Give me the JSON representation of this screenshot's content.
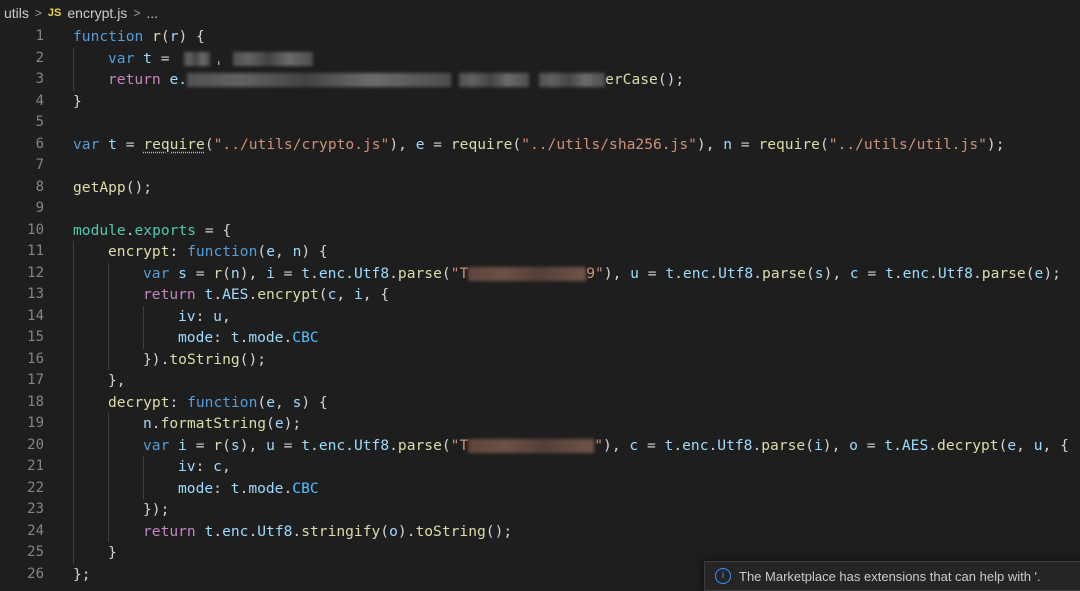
{
  "breadcrumb": {
    "folder": "utils",
    "file_icon": "JS",
    "file": "encrypt.js",
    "more": "..."
  },
  "code_lines": [
    {
      "n": "1"
    },
    {
      "n": "2"
    },
    {
      "n": "3"
    },
    {
      "n": "4"
    },
    {
      "n": "5"
    },
    {
      "n": "6"
    },
    {
      "n": "7"
    },
    {
      "n": "8"
    },
    {
      "n": "9"
    },
    {
      "n": "10"
    },
    {
      "n": "11"
    },
    {
      "n": "12"
    },
    {
      "n": "13"
    },
    {
      "n": "14"
    },
    {
      "n": "15"
    },
    {
      "n": "16"
    },
    {
      "n": "17"
    },
    {
      "n": "18"
    },
    {
      "n": "19"
    },
    {
      "n": "20"
    },
    {
      "n": "21"
    },
    {
      "n": "22"
    },
    {
      "n": "23"
    },
    {
      "n": "24"
    },
    {
      "n": "25"
    },
    {
      "n": "26"
    }
  ],
  "tokens": {
    "l1": {
      "kw": "function",
      "name": "r",
      "open": "(",
      "param": "r",
      "close": ") {"
    },
    "l2": {
      "kw": "var",
      "name": "t",
      "eq": " = ",
      "tick": "ˌ"
    },
    "l3": {
      "kw": "return",
      "obj": "e.",
      "tail": "erCase",
      "end": "();"
    },
    "l4": {
      "t": "}"
    },
    "l6": {
      "kw": "var",
      "t": "t",
      "eq": " = ",
      "req": "require",
      "p1": "(",
      "s1": "\"../utils/crypto.js\"",
      "m1": "), ",
      "e": "e",
      "eq2": " = ",
      "req2": "require",
      "p2": "(",
      "s2": "\"../utils/sha256.js\"",
      "m2": "), ",
      "n": "n",
      "eq3": " = ",
      "req3": "require",
      "p3": "(",
      "s3": "\"../utils/util.js\"",
      "end": ");"
    },
    "l8": {
      "fn": "getApp",
      "end": "();"
    },
    "l10": {
      "mod": "module",
      "dot": ".",
      "exp": "exports",
      "rest": " = {"
    },
    "l11": {
      "name": "encrypt",
      "colon": ": ",
      "kw": "function",
      "open": "(",
      "a": "e",
      "c": ", ",
      "b": "n",
      "close": ") {"
    },
    "l12": {
      "kw": "var",
      "s": "s",
      "eq": " = ",
      "r": "r",
      "o": "(",
      "n": "n",
      "c1": "), ",
      "i": "i",
      "eq2": " = ",
      "t": "t",
      "d1": ".",
      "enc": "enc",
      "d2": ".",
      "utf": "Utf8",
      "d3": ".",
      "parse": "parse",
      "o2": "(",
      "s1": "\"T",
      "s2": "9\"",
      "c2": "), ",
      "u": "u",
      "eq3": " = ",
      "t2": "t",
      "d4": ".",
      "enc2": "enc",
      "d5": ".",
      "utf2": "Utf8",
      "d6": ".",
      "parse2": "parse",
      "o3": "(",
      "sv": "s",
      "c3": "), ",
      "c": "c",
      "eq4": " = ",
      "t3": "t",
      "d7": ".",
      "enc3": "enc",
      "d8": ".",
      "utf3": "Utf8",
      "d9": ".",
      "parse3": "parse",
      "o4": "(",
      "ev": "e",
      "end": ");"
    },
    "l13": {
      "kw": "return",
      "t": "t",
      "d1": ".",
      "aes": "AES",
      "d2": ".",
      "fn": "encrypt",
      "o": "(",
      "c": "c",
      "cm": ", ",
      "i": "i",
      "end": ", {"
    },
    "l14": {
      "k": "iv",
      "c": ": ",
      "v": "u",
      "end": ","
    },
    "l15": {
      "k": "mode",
      "c": ": ",
      "t": "t",
      "d": ".",
      "m": "mode",
      "d2": ".",
      "cbc": "CBC"
    },
    "l16": {
      "a": "})",
      "d": ".",
      "fn": "toString",
      "end": "();"
    },
    "l17": {
      "t": "},"
    },
    "l18": {
      "name": "decrypt",
      "colon": ": ",
      "kw": "function",
      "open": "(",
      "a": "e",
      "c": ", ",
      "b": "s",
      "close": ") {"
    },
    "l19": {
      "n": "n",
      "d": ".",
      "fn": "formatString",
      "o": "(",
      "e": "e",
      "end": ");"
    },
    "l20": {
      "kw": "var",
      "i": "i",
      "eq": " = ",
      "r": "r",
      "o": "(",
      "s": "s",
      "c1": "), ",
      "u": "u",
      "eq2": " = ",
      "t": "t",
      "d1": ".",
      "enc": "enc",
      "d2": ".",
      "utf": "Utf8",
      "d3": ".",
      "parse": "parse",
      "o2": "(",
      "s1": "\"T",
      "s2": "\"",
      "c2": "), ",
      "c": "c",
      "eq3": " = ",
      "t2": "t",
      "d4": ".",
      "enc2": "enc",
      "d5": ".",
      "utf2": "Utf8",
      "d6": ".",
      "parse2": "parse",
      "o3": "(",
      "iv": "i",
      "c3": "), ",
      "ov": "o",
      "eq4": " = ",
      "t3": "t",
      "d7": ".",
      "aes": "AES",
      "d8": ".",
      "dec": "decrypt",
      "o4": "(",
      "ev": "e",
      "cm": ", ",
      "uv": "u",
      "end": ", {"
    },
    "l21": {
      "k": "iv",
      "c": ": ",
      "v": "c",
      "end": ","
    },
    "l22": {
      "k": "mode",
      "c": ": ",
      "t": "t",
      "d": ".",
      "m": "mode",
      "d2": ".",
      "cbc": "CBC"
    },
    "l23": {
      "t": "});"
    },
    "l24": {
      "kw": "return",
      "t": "t",
      "d1": ".",
      "enc": "enc",
      "d2": ".",
      "utf": "Utf8",
      "d3": ".",
      "fn": "stringify",
      "o": "(",
      "ov": "o",
      "c": ")",
      "d4": ".",
      "fn2": "toString",
      "end": "();"
    },
    "l25": {
      "t": "}"
    },
    "l26": {
      "t": "};"
    }
  },
  "notification": {
    "icon": "info-icon",
    "text": "The Marketplace has extensions that can help with '."
  },
  "colors": {
    "background": "#1e1e1e",
    "keyword": "#569cd6",
    "control": "#c586c0",
    "function": "#dcdcaa",
    "variable": "#9cdcfe",
    "string": "#ce9178",
    "class": "#4ec9b0",
    "constant": "#4fc1ff"
  }
}
